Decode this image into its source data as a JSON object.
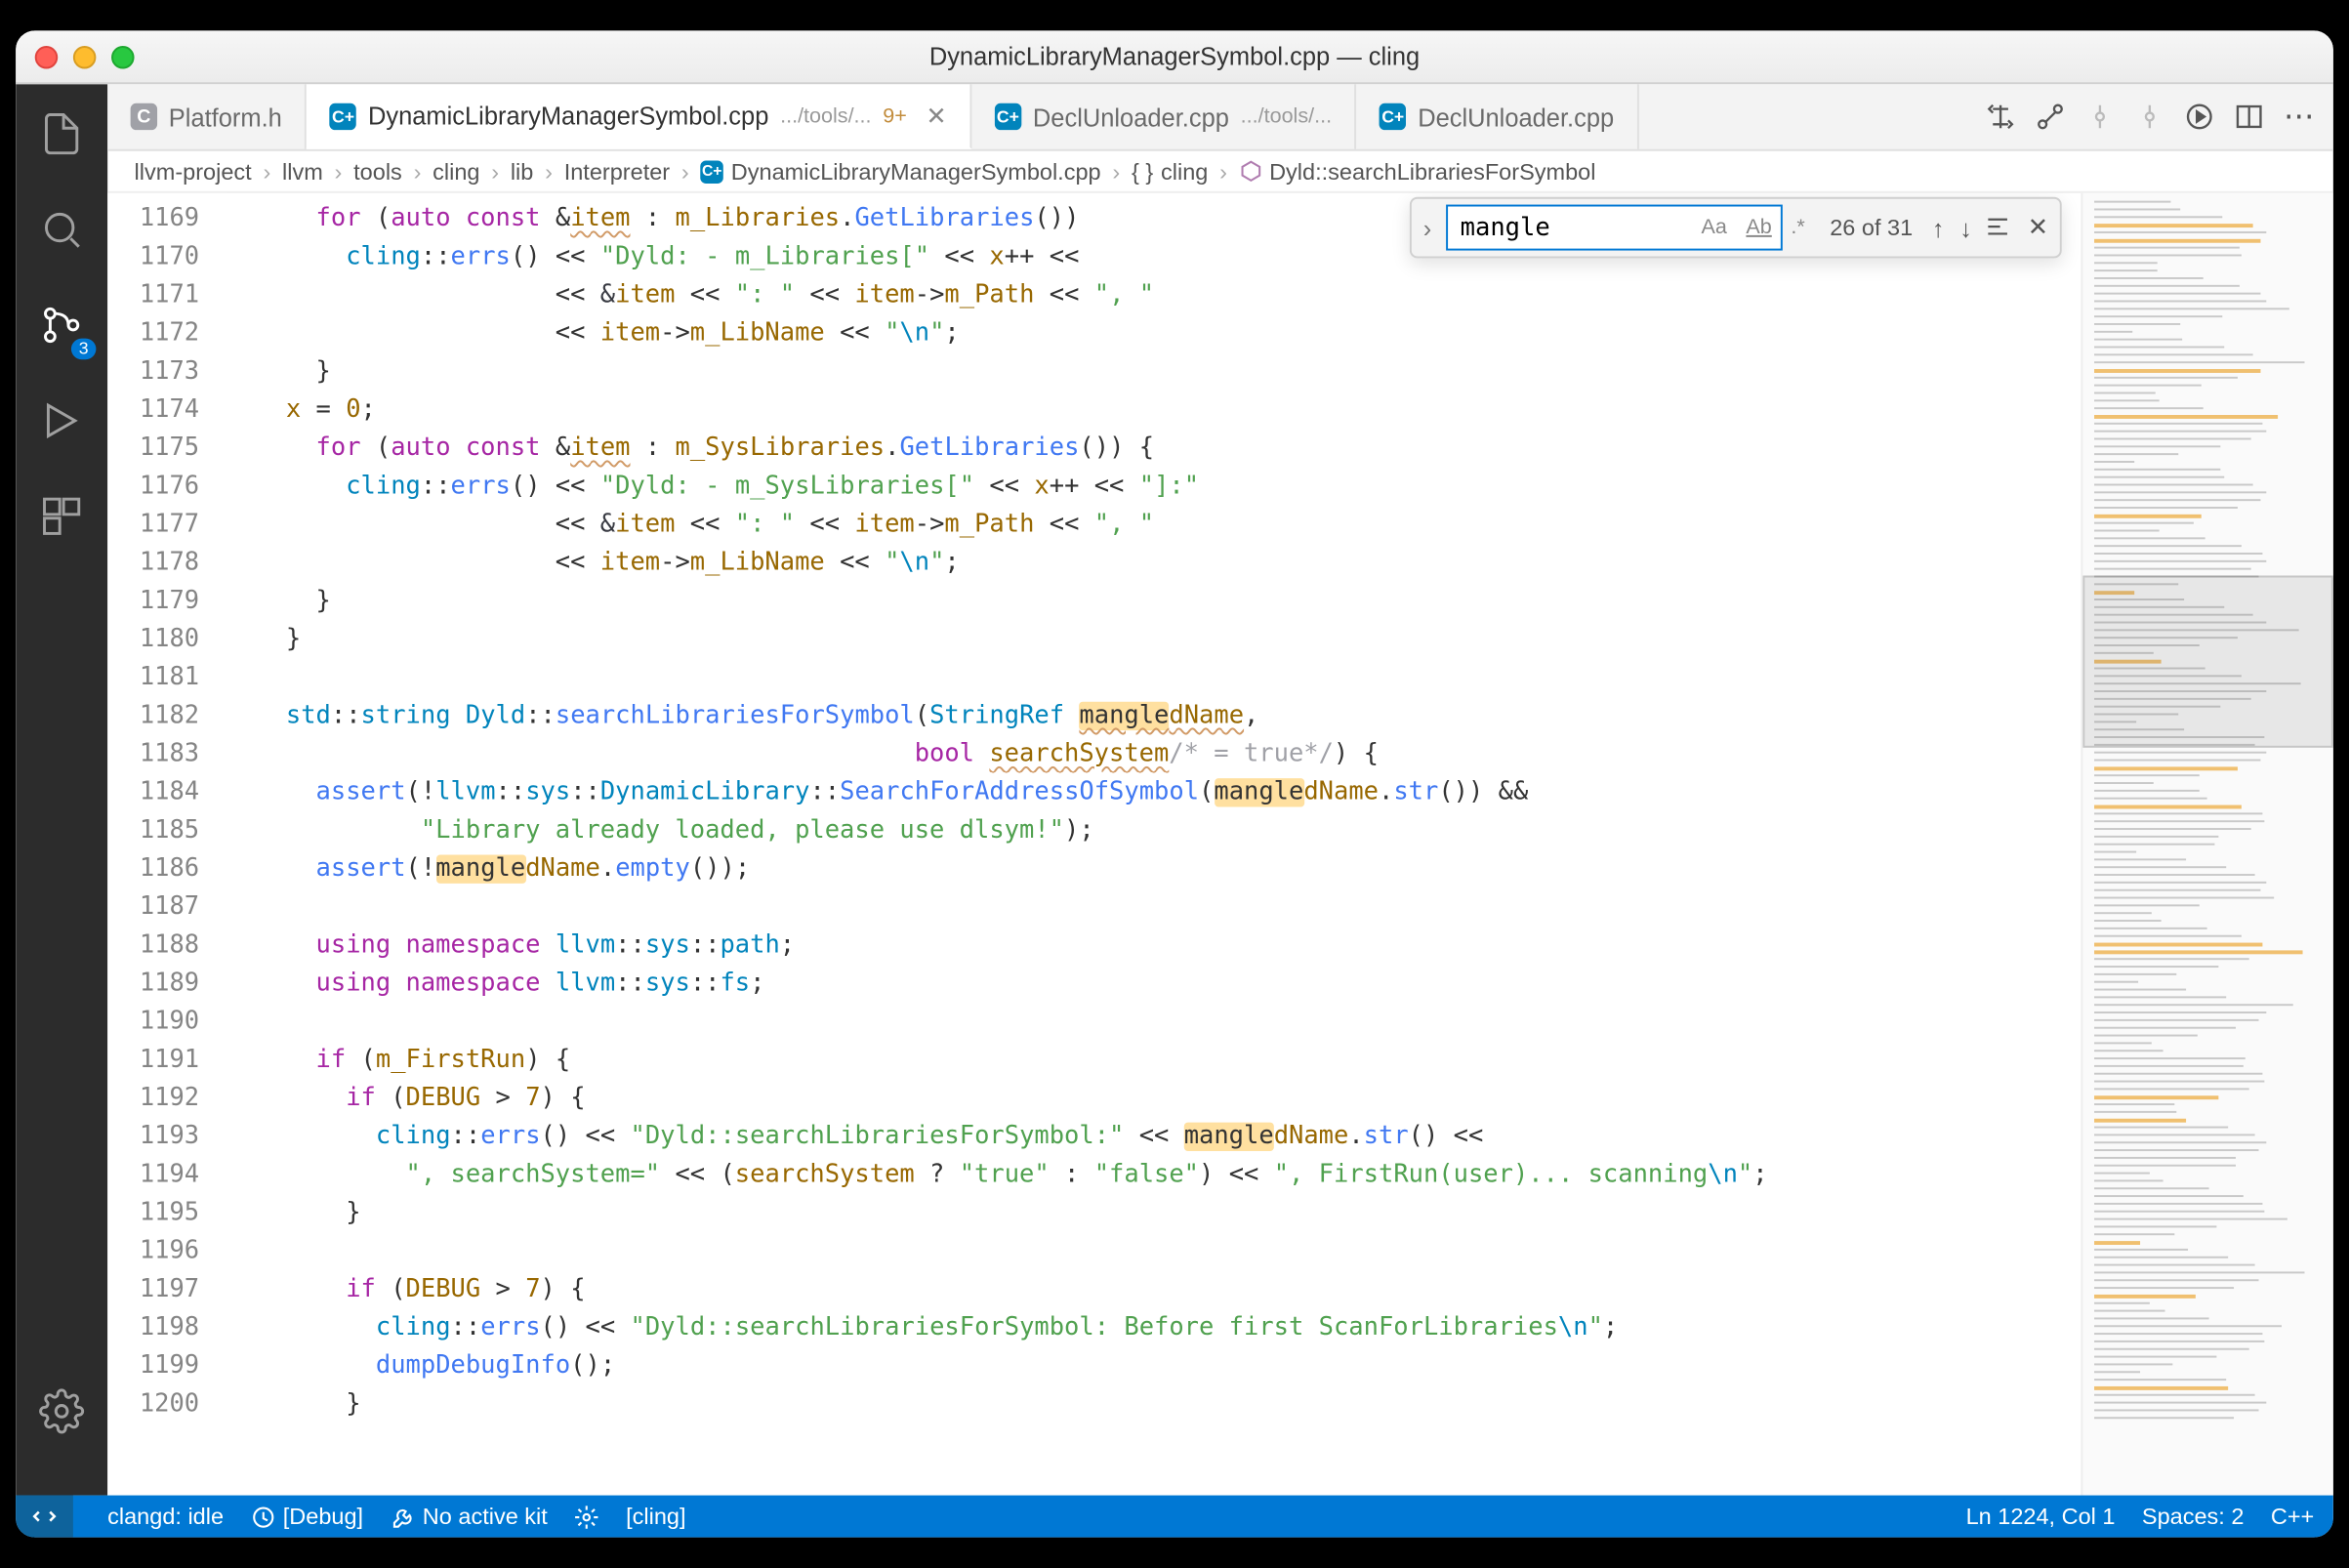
{
  "window": {
    "title": "DynamicLibraryManagerSymbol.cpp — cling"
  },
  "tabs": {
    "items": [
      {
        "icon": "h",
        "label": "Platform.h",
        "desc": "",
        "dirty": "",
        "active": false,
        "close": false
      },
      {
        "icon": "cpp",
        "label": "DynamicLibraryManagerSymbol.cpp",
        "desc": ".../tools/...",
        "dirty": "9+",
        "active": true,
        "close": true
      },
      {
        "icon": "cpp",
        "label": "DeclUnloader.cpp",
        "desc": ".../tools/...",
        "dirty": "",
        "active": false,
        "close": false
      },
      {
        "icon": "cpp",
        "label": "DeclUnloader.cpp",
        "desc": "",
        "dirty": "",
        "active": false,
        "close": false
      }
    ]
  },
  "breadcrumbs": {
    "items": [
      {
        "kind": "folder",
        "label": "llvm-project"
      },
      {
        "kind": "folder",
        "label": "llvm"
      },
      {
        "kind": "folder",
        "label": "tools"
      },
      {
        "kind": "folder",
        "label": "cling"
      },
      {
        "kind": "folder",
        "label": "lib"
      },
      {
        "kind": "folder",
        "label": "Interpreter"
      },
      {
        "kind": "file-cpp",
        "label": "DynamicLibraryManagerSymbol.cpp"
      },
      {
        "kind": "ns",
        "label": "cling"
      },
      {
        "kind": "method",
        "label": "Dyld::searchLibrariesForSymbol"
      }
    ]
  },
  "find": {
    "value": "mangle",
    "count": "26 of 31"
  },
  "activitybar": {
    "scm_badge": "3"
  },
  "status": {
    "remote": "",
    "clangd": "clangd: idle",
    "debug": "[Debug]",
    "kit": "No active kit",
    "variant": "[cling]",
    "lncol": "Ln 1224, Col 1",
    "spaces": "Spaces: 2",
    "lang": "C++"
  },
  "lines": {
    "start": 1169,
    "count": 32
  },
  "code": {
    "l1169": {
      "a": "for",
      "b": "auto const",
      "c": "item",
      "d": "m_Libraries",
      "e": "GetLibraries"
    },
    "l1170": {
      "a": "cling",
      "b": "errs",
      "c": "\"Dyld: - m_Libraries[\"",
      "d": "x"
    },
    "l1171": {
      "a": "&",
      "b": "item",
      "c": "\": \"",
      "d": "item",
      "e": "m_Path",
      "f": "\", \""
    },
    "l1172": {
      "a": "item",
      "b": "m_LibName",
      "c": "\"\\n\""
    },
    "l1174": {
      "a": "x",
      "b": "0"
    },
    "l1175": {
      "a": "for",
      "b": "auto const",
      "c": "item",
      "d": "m_SysLibraries",
      "e": "GetLibraries"
    },
    "l1176": {
      "a": "cling",
      "b": "errs",
      "c": "\"Dyld: - m_SysLibraries[\"",
      "d": "x",
      "e": "\"]:\""
    },
    "l1177": {
      "a": "&",
      "b": "item",
      "c": "\": \"",
      "d": "item",
      "e": "m_Path",
      "f": "\", \""
    },
    "l1178": {
      "a": "item",
      "b": "m_LibName",
      "c": "\"\\n\""
    },
    "l1182": {
      "a": "std",
      "b": "string",
      "c": "Dyld",
      "d": "searchLibrariesForSymbol",
      "e": "StringRef",
      "f": "mangle",
      "g": "dName"
    },
    "l1183": {
      "a": "bool",
      "b": "searchSystem",
      "c": "/* = true*/"
    },
    "l1184": {
      "a": "assert",
      "b": "llvm",
      "c": "sys",
      "d": "DynamicLibrary",
      "e": "SearchForAddressOfSymbol",
      "f": "mangle",
      "g": "dName",
      "h": "str"
    },
    "l1185": {
      "a": "\"Library already loaded, please use dlsym!\""
    },
    "l1186": {
      "a": "assert",
      "b": "mangle",
      "c": "dName",
      "d": "empty"
    },
    "l1188": {
      "a": "using namespace",
      "b": "llvm",
      "c": "sys",
      "d": "path"
    },
    "l1189": {
      "a": "using namespace",
      "b": "llvm",
      "c": "sys",
      "d": "fs"
    },
    "l1191": {
      "a": "if",
      "b": "m_FirstRun"
    },
    "l1192": {
      "a": "if",
      "b": "DEBUG",
      "c": "7"
    },
    "l1193": {
      "a": "cling",
      "b": "errs",
      "c": "\"Dyld::searchLibrariesForSymbol:\"",
      "d": "mangle",
      "e": "dName",
      "f": "str"
    },
    "l1194": {
      "a": "\", searchSystem=\"",
      "b": "searchSystem",
      "c": "\"true\"",
      "d": "\"false\"",
      "e": "\", FirstRun(user)... scanning\\n\""
    },
    "l1197": {
      "a": "if",
      "b": "DEBUG",
      "c": "7"
    },
    "l1198": {
      "a": "cling",
      "b": "errs",
      "c": "\"Dyld::searchLibrariesForSymbol: Before first ScanForLibraries\\n\""
    },
    "l1199": {
      "a": "dumpDebugInfo"
    }
  }
}
